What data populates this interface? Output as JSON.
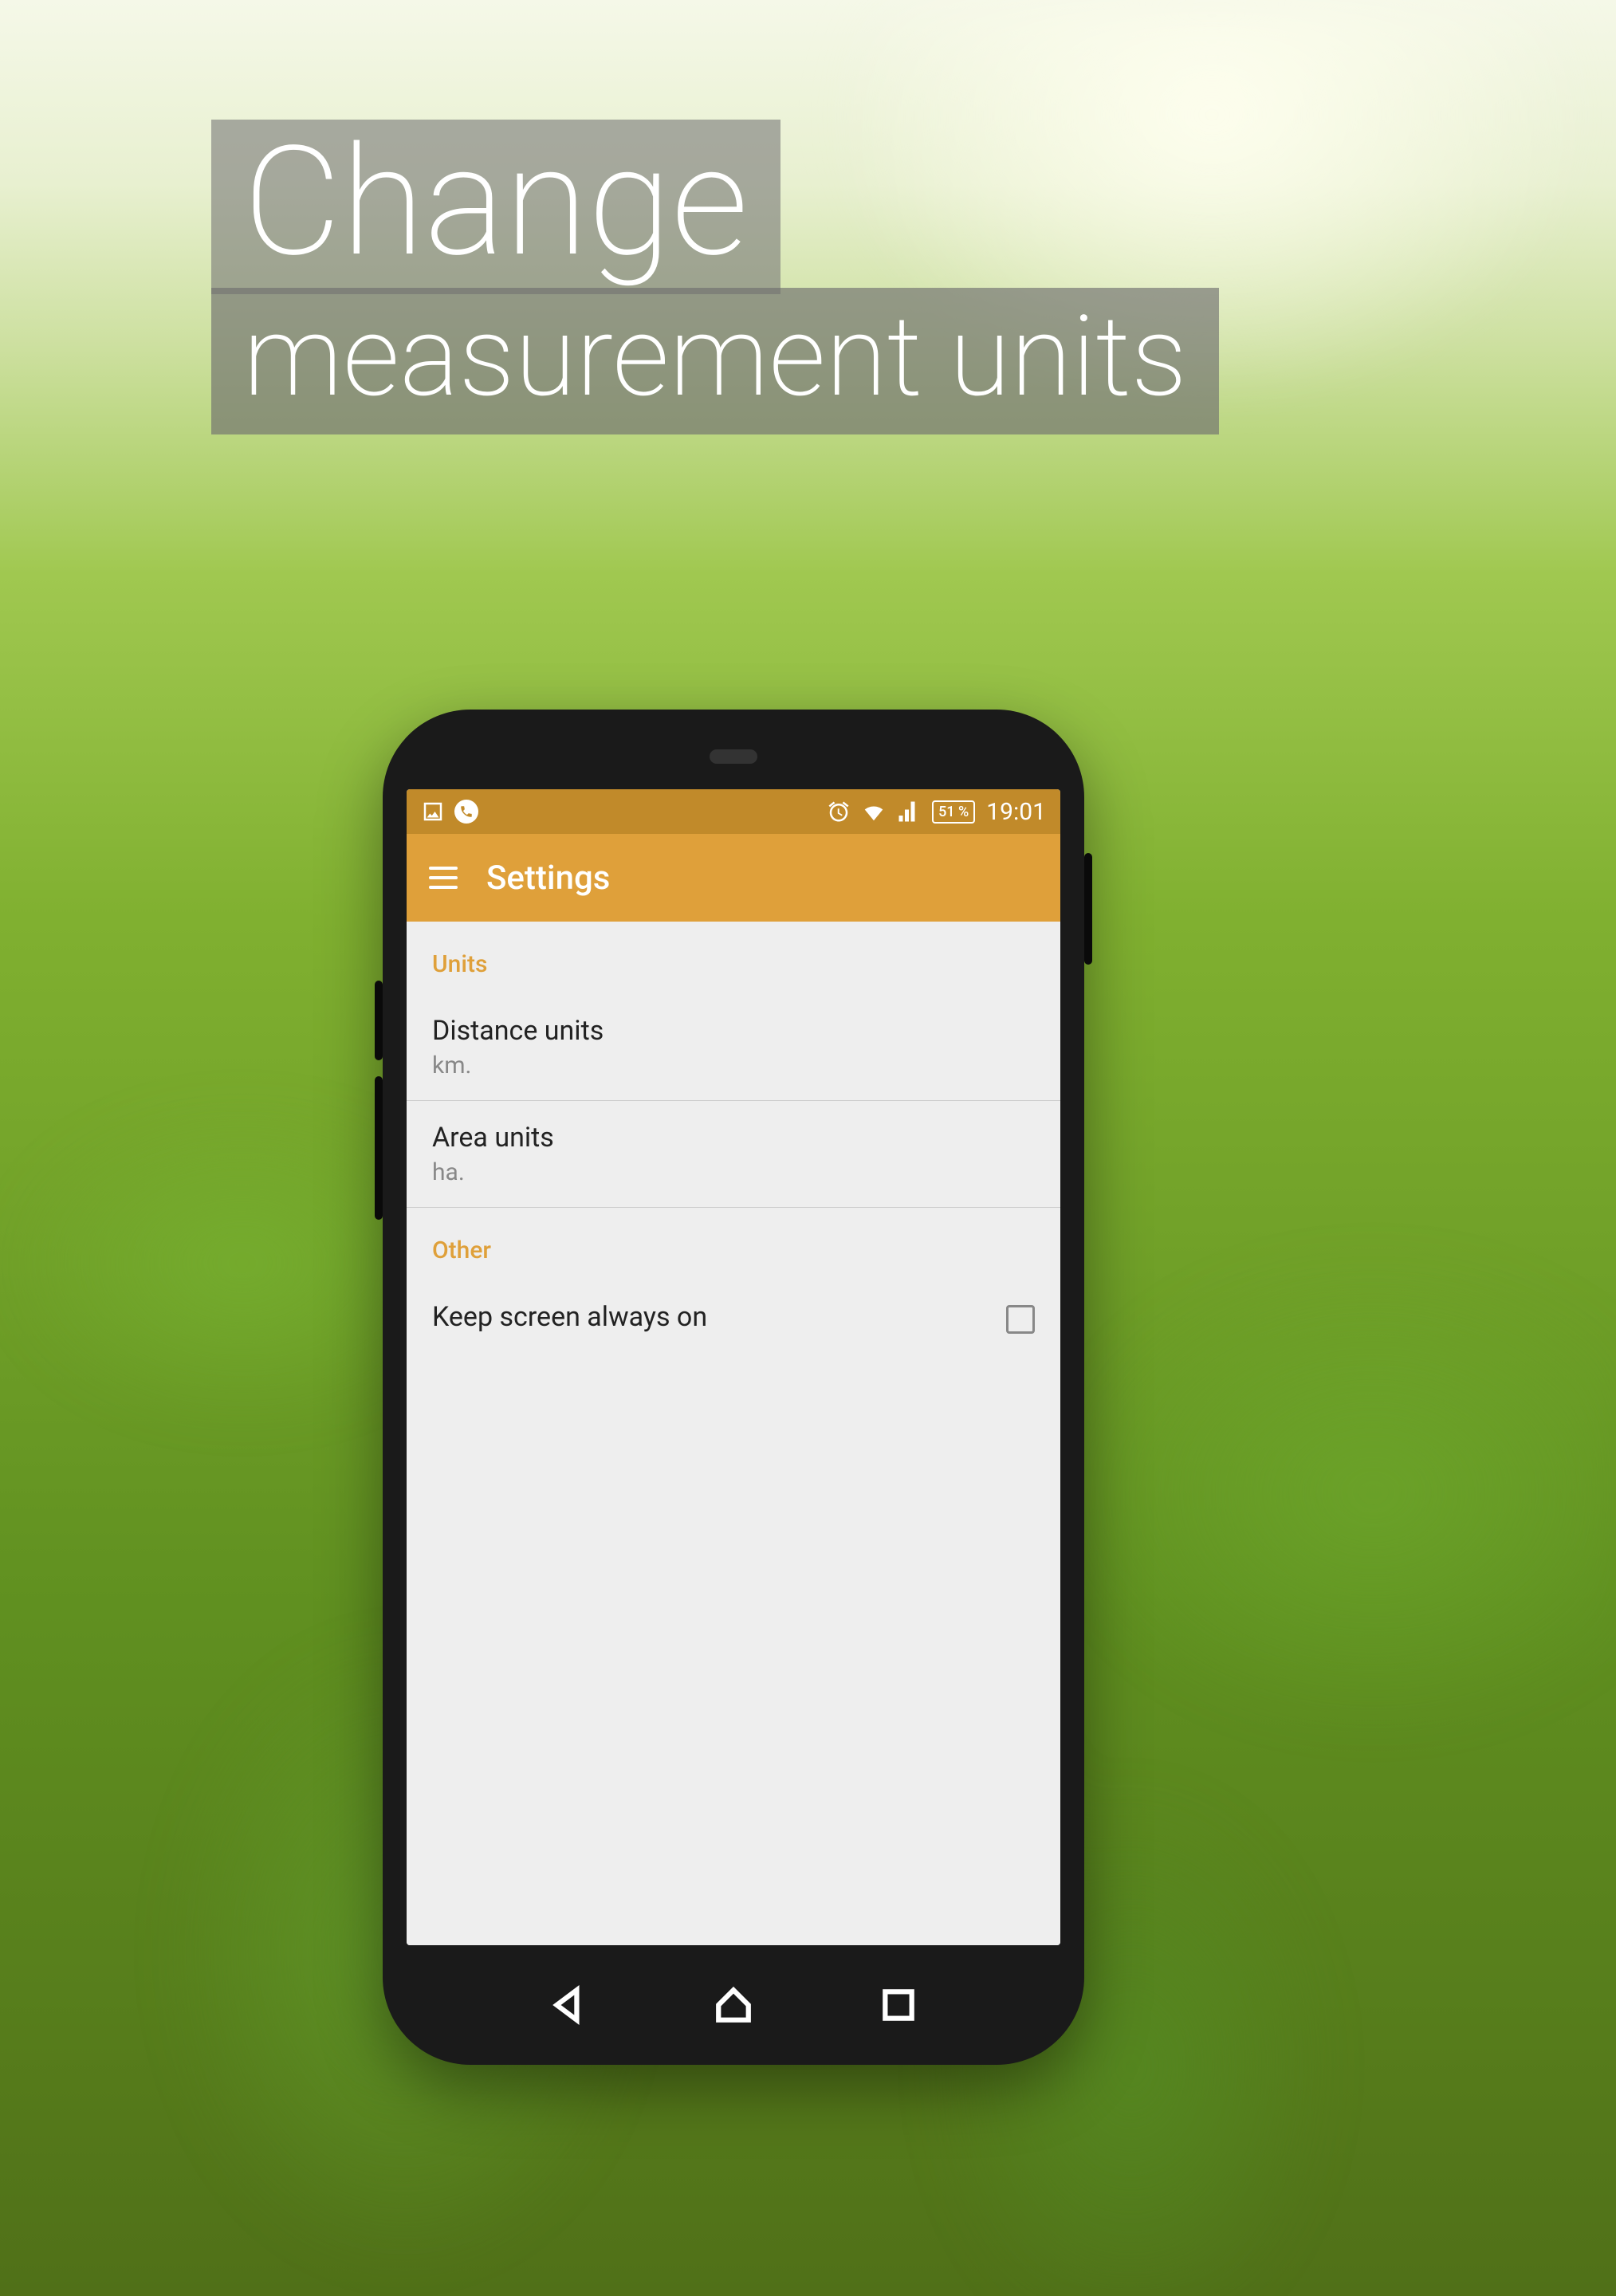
{
  "promo": {
    "line1": "Change",
    "line2": "measurement units"
  },
  "status_bar": {
    "battery": "51 %",
    "time": "19:01"
  },
  "app_bar": {
    "title": "Settings"
  },
  "sections": {
    "units": {
      "header": "Units",
      "items": [
        {
          "title": "Distance units",
          "value": "km."
        },
        {
          "title": "Area units",
          "value": "ha."
        }
      ]
    },
    "other": {
      "header": "Other",
      "items": [
        {
          "title": "Keep screen always on",
          "checked": false
        }
      ]
    }
  }
}
